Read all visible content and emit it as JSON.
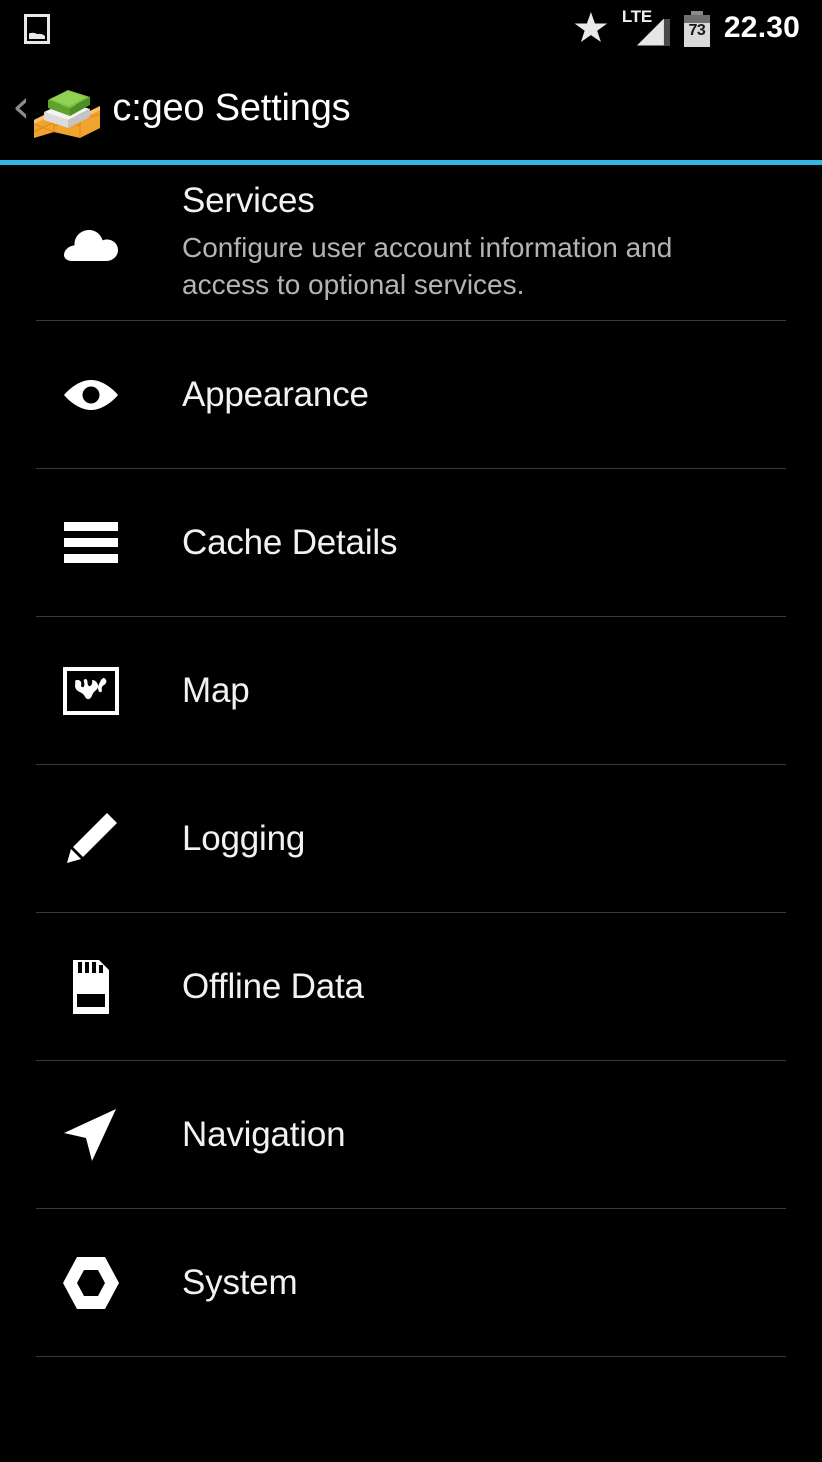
{
  "status_bar": {
    "left_icons": [
      {
        "name": "photo-icon",
        "label": "image"
      }
    ],
    "right_icons": [
      {
        "name": "star-icon",
        "label": "star"
      },
      {
        "name": "signal-icon",
        "label": "LTE"
      },
      {
        "name": "battery-icon",
        "label": "73"
      }
    ],
    "network_label": "LTE",
    "battery_percent": "73",
    "clock": "22.30"
  },
  "title_bar": {
    "back_label": "‹",
    "app_icon": "cgeo-logo-icon",
    "title": "c:geo Settings",
    "accent_color": "#33b5e5"
  },
  "settings": {
    "items": [
      {
        "icon": "cloud-icon",
        "title": "Services",
        "summary": "Configure user account information and access to optional services."
      },
      {
        "icon": "eye-icon",
        "title": "Appearance",
        "summary": ""
      },
      {
        "icon": "list-icon",
        "title": "Cache Details",
        "summary": ""
      },
      {
        "icon": "map-icon",
        "title": "Map",
        "summary": ""
      },
      {
        "icon": "pencil-icon",
        "title": "Logging",
        "summary": ""
      },
      {
        "icon": "sd-card-icon",
        "title": "Offline Data",
        "summary": ""
      },
      {
        "icon": "navigation-arrow-icon",
        "title": "Navigation",
        "summary": ""
      },
      {
        "icon": "hex-nut-icon",
        "title": "System",
        "summary": ""
      }
    ]
  },
  "colors": {
    "background": "#000000",
    "accent": "#33b5e5",
    "title_text": "#ffffff",
    "summary_text": "#b4b4b4",
    "divider": "#3a3a3a"
  }
}
